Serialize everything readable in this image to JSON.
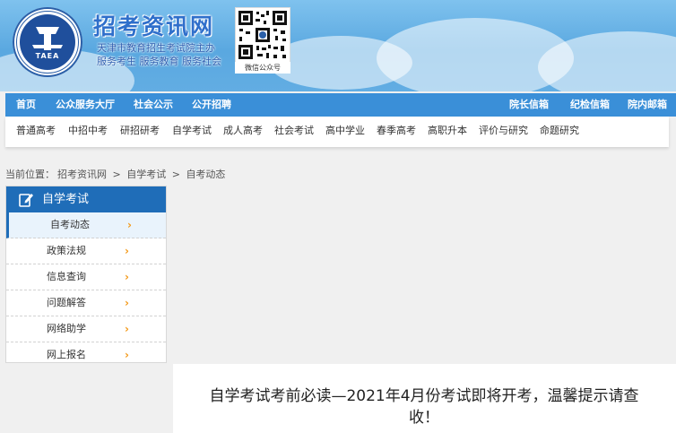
{
  "header": {
    "site_title": "招考资讯网",
    "slogan_line1": "天津市教育招生考试院主办",
    "slogan_line2": "服务考生 服务教育 服务社会",
    "logo_text": "TAEA",
    "qr_label": "微信公众号"
  },
  "main_nav": {
    "items": [
      "首页",
      "公众服务大厅",
      "社会公示",
      "公开招聘"
    ],
    "right_items": [
      "院长信箱",
      "纪检信箱",
      "院内邮箱"
    ]
  },
  "sub_nav": {
    "items": [
      "普通高考",
      "中招中考",
      "研招研考",
      "自学考试",
      "成人高考",
      "社会考试",
      "高中学业",
      "春季高考",
      "高职升本",
      "评价与研究",
      "命题研究"
    ]
  },
  "breadcrumb": {
    "items": [
      "当前位置：",
      "招考资讯网",
      ">",
      "自学考试",
      ">",
      "自考动态"
    ]
  },
  "sidebar": {
    "title": "自学考试",
    "items": [
      "自考动态",
      "政策法规",
      "信息查询",
      "问题解答",
      "网络助学",
      "网上报名"
    ],
    "chevron": "›"
  },
  "article": {
    "title": "自学考试考前必读—2021年4月份考试即将开考，温馨提示请查收！"
  },
  "colors": {
    "nav_blue": "#3a8fd8",
    "sidebar_blue": "#1f6db8",
    "chevron_orange": "#f39a1a"
  }
}
